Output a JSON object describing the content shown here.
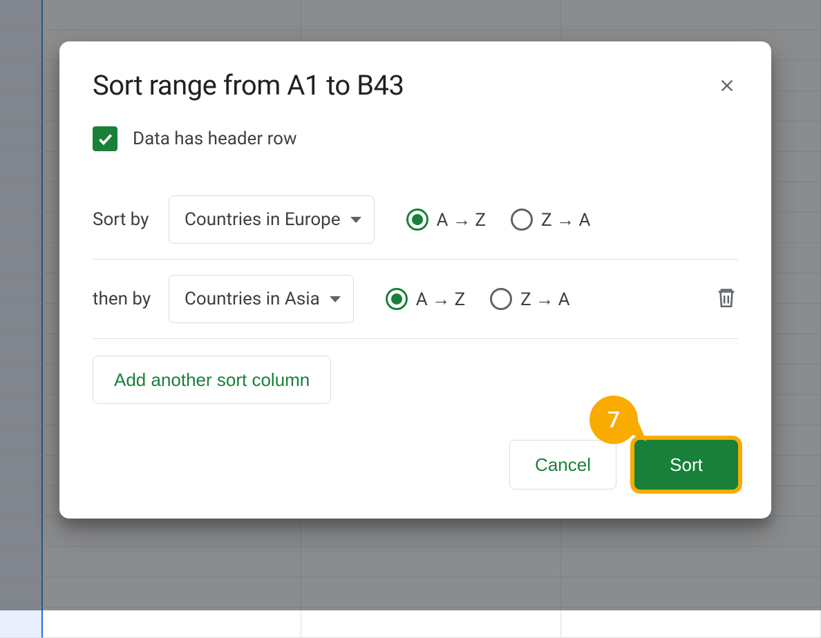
{
  "dialog": {
    "title": "Sort range from A1 to B43",
    "header_checkbox_label": "Data has header row",
    "header_checkbox_checked": true,
    "rules": [
      {
        "prefix": "Sort by",
        "column": "Countries in Europe",
        "az_label": "A → Z",
        "za_label": "Z → A",
        "selected": "az",
        "deletable": false
      },
      {
        "prefix": "then by",
        "column": "Countries in Asia",
        "az_label": "A → Z",
        "za_label": "Z → A",
        "selected": "az",
        "deletable": true
      }
    ],
    "add_button": "Add another sort column",
    "cancel_button": "Cancel",
    "sort_button": "Sort"
  },
  "annotation": {
    "step": "7"
  },
  "colors": {
    "accent_green": "#188038",
    "callout_yellow": "#f9ab00"
  }
}
